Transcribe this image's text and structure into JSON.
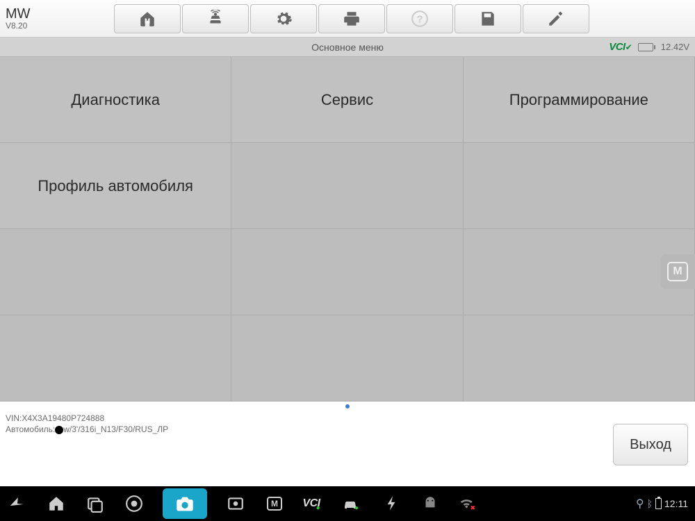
{
  "brand": {
    "title": "MW",
    "version": "V8.20"
  },
  "statusbar": {
    "title": "Основное меню",
    "vci_label": "VCI",
    "voltage": "12.42V"
  },
  "grid": {
    "cells": [
      "Диагностика",
      "Сервис",
      "Программирование",
      "Профиль автомобиля",
      "",
      "",
      "",
      "",
      "",
      "",
      "",
      ""
    ]
  },
  "footer": {
    "vin_label": "VIN:",
    "vin": "X4X3A19480P724888",
    "car_label": "Автомобиль:",
    "car_value": "w/3'/316i_N13/F30/RUS_ЛР",
    "exit_label": "Выход"
  },
  "nav": {
    "clock": "12:11",
    "vci": "VCI"
  }
}
